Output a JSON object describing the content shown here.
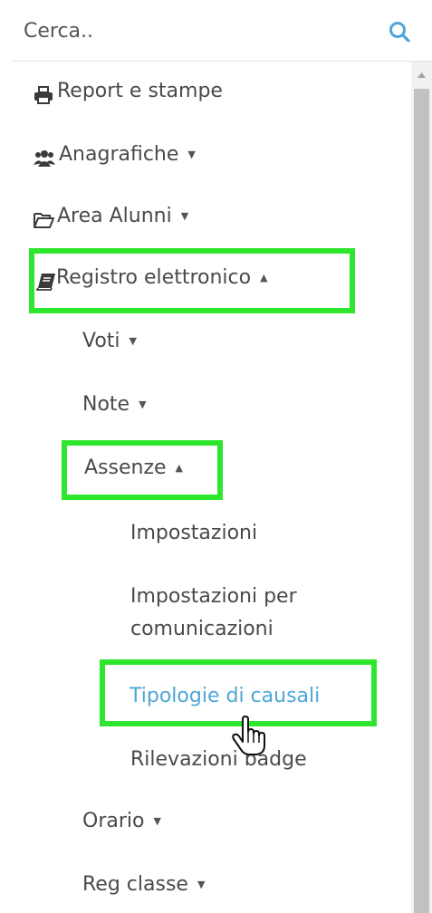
{
  "search": {
    "placeholder": "Cerca..",
    "icon": "search-icon"
  },
  "menu": {
    "report": {
      "label": "Report e stampe",
      "icon": "print-icon"
    },
    "anagrafiche": {
      "label": "Anagrafiche",
      "icon": "users-icon",
      "caret": "▼"
    },
    "area_alunni": {
      "label": "Area Alunni",
      "icon": "folder-open-icon",
      "caret": "▼"
    },
    "registro": {
      "label": "Registro elettronico",
      "icon": "book-icon",
      "caret": "▲"
    },
    "voti": {
      "label": "Voti",
      "caret": "▼"
    },
    "note": {
      "label": "Note",
      "caret": "▼"
    },
    "assenze": {
      "label": "Assenze",
      "caret": "▲"
    },
    "impostazioni": {
      "label": "Impostazioni"
    },
    "impostazioni_comunicazioni": {
      "line1": "Impostazioni per",
      "line2": "comunicazioni"
    },
    "tipologie": {
      "label": "Tipologie di causali"
    },
    "rilevazioni": {
      "label": "Rilevazioni badge"
    },
    "orario": {
      "label": "Orario",
      "caret": "▼"
    },
    "reg_classe": {
      "label": "Reg classe",
      "caret": "▼"
    }
  },
  "colors": {
    "highlight": "#2ee62e",
    "active_link": "#4ea6d8",
    "search_icon": "#4ea6d8"
  }
}
